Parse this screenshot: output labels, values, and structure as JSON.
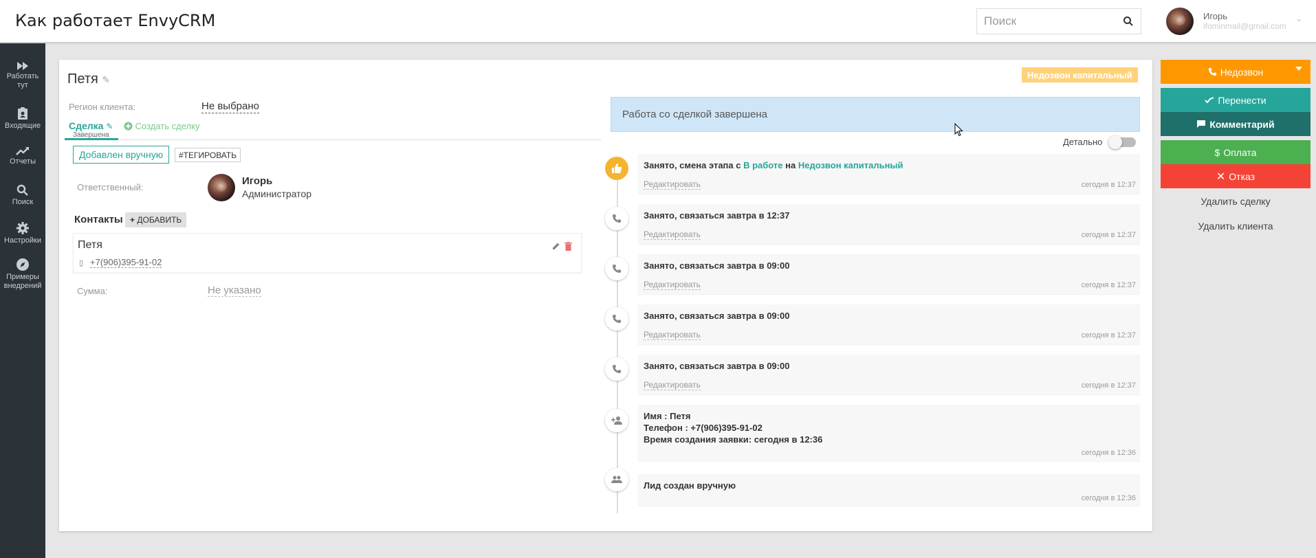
{
  "header": {
    "app_title": "Как работает EnvyCRM",
    "search_placeholder": "Поиск",
    "user_name": "Игорь",
    "user_email": "ifominmail@gmail.com"
  },
  "sidebar": {
    "items": [
      {
        "label": "Работать тут",
        "icon": "fast-forward-icon"
      },
      {
        "label": "Входящие",
        "icon": "clipboard-user-icon"
      },
      {
        "label": "Отчеты",
        "icon": "trending-up-icon"
      },
      {
        "label": "Поиск",
        "icon": "search-icon"
      },
      {
        "label": "Настройки",
        "icon": "gear-icon"
      },
      {
        "label": "Примеры внедрений",
        "icon": "compass-icon"
      }
    ]
  },
  "client": {
    "name": "Петя",
    "region_label": "Регион клиента:",
    "region_value": "Не выбрано",
    "deal_tab": "Сделка",
    "deal_status": "Завершена",
    "create_deal": "Создать сделку",
    "manual_button": "Добавлен вручную",
    "tag_button": "#ТЕГИРОВАТЬ",
    "responsible_label": "Ответственный:",
    "responsible_name": "Игорь",
    "responsible_role": "Администратор",
    "contacts_title": "Контакты",
    "add_button": "ДОБАВИТЬ",
    "contact": {
      "name": "Петя",
      "phone": "+7(906)395-91-02"
    },
    "sum_label": "Сумма:",
    "sum_value": "Не указано"
  },
  "status_badge": "Недозвон капитальный",
  "banner": "Работа со сделкой завершена",
  "detail_label": "Детально",
  "timeline": {
    "edit_label": "Редактировать",
    "events": [
      {
        "icon": "thumbs-up-icon",
        "prefix": "Занято, смена этапа с ",
        "from": "В работе",
        "mid": " на ",
        "to": "Недозвон капитальный",
        "time": "сегодня в 12:37"
      },
      {
        "icon": "phone-icon",
        "text": "Занято, связаться завтра в 12:37",
        "time": "сегодня в 12:37"
      },
      {
        "icon": "phone-icon",
        "text": "Занято, связаться завтра в 09:00",
        "time": "сегодня в 12:37"
      },
      {
        "icon": "phone-icon",
        "text": "Занято, связаться завтра в 09:00",
        "time": "сегодня в 12:37"
      },
      {
        "icon": "phone-icon",
        "text": "Занято, связаться завтра в 09:00",
        "time": "сегодня в 12:37"
      },
      {
        "icon": "person-add-icon",
        "line1": "Имя : Петя",
        "line2": "Телефон : +7(906)395-91-02",
        "line3": "Время создания заявки: сегодня в 12:36",
        "time": "сегодня в 12:36"
      },
      {
        "icon": "people-icon",
        "text": "Лид создан вручную",
        "time": "сегодня в 12:36"
      }
    ]
  },
  "actions": {
    "nodozvon": "Недозвон",
    "transfer": "Перенести",
    "comment": "Комментарий",
    "payment": "Оплата",
    "refuse": "Отказ",
    "delete_deal": "Удалить сделку",
    "delete_client": "Удалить клиента"
  },
  "colors": {
    "orange": "#ff9800",
    "teal": "#26a69a",
    "dark_teal": "#1f6f6a",
    "green": "#4caf50",
    "red": "#f44336",
    "sidebar": "#2b3238"
  }
}
